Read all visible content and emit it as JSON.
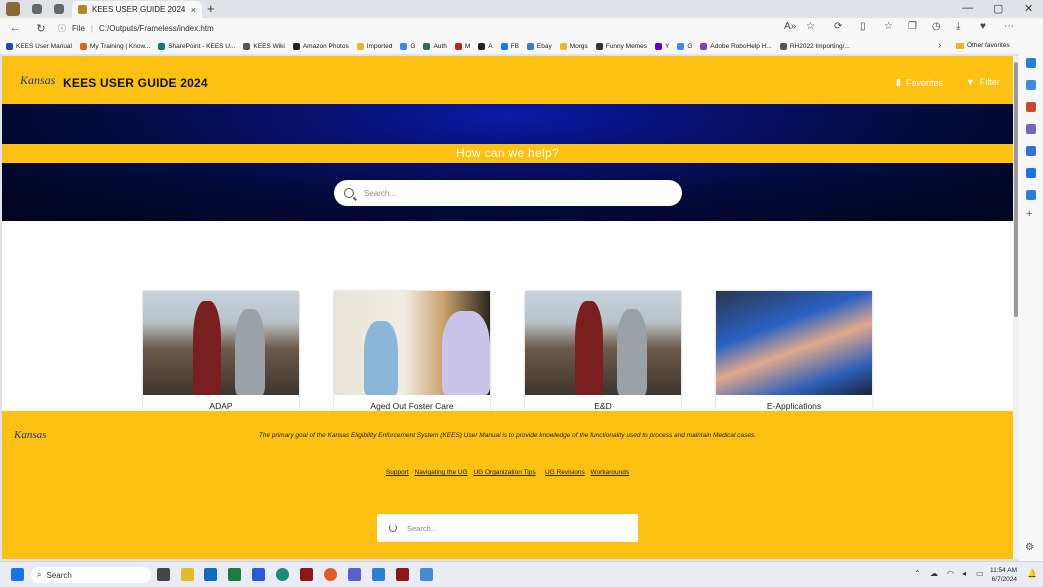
{
  "browser": {
    "tab_title": "KEES USER GUIDE 2024",
    "tab_close": "×",
    "new_tab": "+",
    "address_label": "File",
    "url": "C:/Outputs/Frameless/index.htm",
    "nav": {
      "back": "←",
      "refresh": "↻",
      "info": "ⓘ"
    },
    "bookmarks": [
      {
        "label": "KEES User Manual",
        "color": "#1a4fb5"
      },
      {
        "label": "My Training | Know...",
        "color": "#e0621d"
      },
      {
        "label": "SharePoint - KEES U...",
        "color": "#0a7a7a"
      },
      {
        "label": "KEES Wiki",
        "color": "#555555"
      },
      {
        "label": "Amazon Photos",
        "color": "#222222"
      },
      {
        "label": "Imported",
        "color": "#e8b730"
      },
      {
        "label": "G",
        "color": "#4285f4"
      },
      {
        "label": "Auth",
        "color": "#2f6f4f"
      },
      {
        "label": "M",
        "color": "#c5221f"
      },
      {
        "label": "A",
        "color": "#222222"
      },
      {
        "label": "FB",
        "color": "#1877f2"
      },
      {
        "label": "Ebay",
        "color": "#3b7bd1"
      },
      {
        "label": "Morgs",
        "color": "#e8b730"
      },
      {
        "label": "Funny Memes",
        "color": "#333333"
      },
      {
        "label": "Y",
        "color": "#5f01d1"
      },
      {
        "label": "G",
        "color": "#4285f4"
      },
      {
        "label": "Adobe RoboHelp H...",
        "color": "#7b3fbf"
      },
      {
        "label": "RH2022 Importing/...",
        "color": "#555555"
      }
    ],
    "bookmarks_more": "›",
    "other_favorites": "Other favorites"
  },
  "page": {
    "site_title": "KEES USER GUIDE 2024",
    "logo_text": "Kansas",
    "header_links": {
      "favorites": "Favorites",
      "filter": "Filter"
    },
    "hero_heading": "How can we help?",
    "search_placeholder": "Search...",
    "cards": [
      {
        "label": "ADAP"
      },
      {
        "label": "Aged Out Foster Care"
      },
      {
        "label": "E&D"
      },
      {
        "label": "E-Applications"
      }
    ],
    "footer": {
      "logo_text": "Kansas",
      "tagline": "The primary goal of the Kansas Eligibility Enforcement System (KEES) User Manual is to provide knowledge of the functionality used to process and maintain Medical cases.",
      "links": [
        "Support",
        "Navigating the UG",
        "UG Organization Tips",
        "UG Revisions",
        "Workarounds"
      ],
      "search_placeholder": "Search..."
    }
  },
  "taskbar": {
    "search_label": "Search",
    "time": "11:54 AM",
    "date": "6/7/2024"
  },
  "colors": {
    "brand_yellow": "#fdc114",
    "hero_navy": "#040a3a"
  }
}
